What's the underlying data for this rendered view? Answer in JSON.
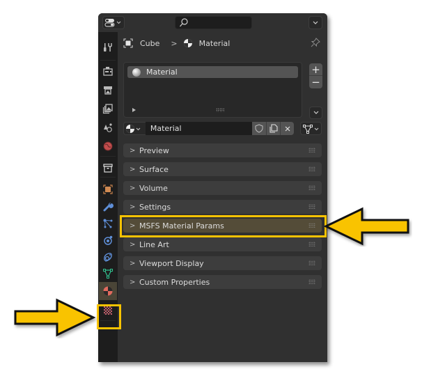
{
  "header": {
    "editor_type_icon": "properties-editor-icon",
    "search_placeholder": "",
    "options_icon": "chevron-down-icon"
  },
  "breadcrumb": {
    "object": "Cube",
    "separator": ">",
    "material": "Material"
  },
  "material_slots": {
    "items": [
      {
        "label": "Material",
        "selected": true
      }
    ],
    "add_label": "+",
    "remove_label": "−"
  },
  "material_selector": {
    "value": "Material"
  },
  "sidebar_tabs": [
    {
      "name": "tool",
      "icon": "tool-icon"
    },
    {
      "name": "render",
      "icon": "render-icon"
    },
    {
      "name": "output",
      "icon": "output-icon"
    },
    {
      "name": "view-layer",
      "icon": "view-layer-icon"
    },
    {
      "name": "scene",
      "icon": "scene-icon"
    },
    {
      "name": "world",
      "icon": "world-icon"
    },
    {
      "name": "collection",
      "icon": "collection-icon"
    },
    {
      "name": "object",
      "icon": "object-icon"
    },
    {
      "name": "modifiers",
      "icon": "wrench-icon"
    },
    {
      "name": "particles",
      "icon": "particles-icon"
    },
    {
      "name": "physics",
      "icon": "physics-icon"
    },
    {
      "name": "constraints",
      "icon": "constraints-icon"
    },
    {
      "name": "data",
      "icon": "mesh-data-icon"
    },
    {
      "name": "material",
      "icon": "material-icon",
      "active": true
    },
    {
      "name": "texture",
      "icon": "texture-icon"
    }
  ],
  "panels": [
    {
      "label": "Preview"
    },
    {
      "label": "Surface"
    },
    {
      "label": "Volume"
    },
    {
      "label": "Settings"
    },
    {
      "label": "MSFS Material Params",
      "highlighted": true
    },
    {
      "label": "Line Art"
    },
    {
      "label": "Viewport Display"
    },
    {
      "label": "Custom Properties"
    }
  ],
  "annotations": {
    "highlight_color": "#f9c300",
    "arrow_color": "#f9c300"
  }
}
